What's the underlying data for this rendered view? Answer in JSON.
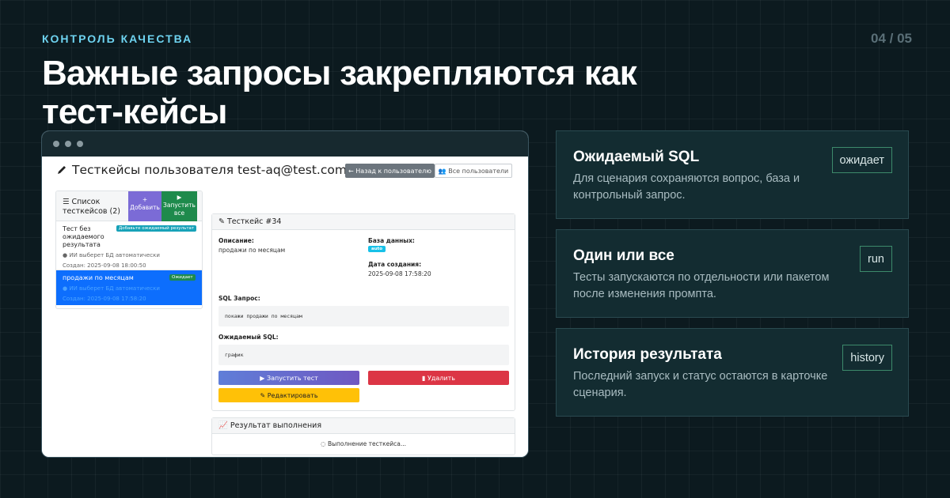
{
  "eyebrow": "КОНТРОЛЬ КАЧЕСТВА",
  "pager": "04 / 05",
  "headline": "Важные запросы закрепляются как тест-кейсы",
  "app": {
    "title": "Тесткейсы пользователя test-aq@test.com",
    "back_button": "Назад к пользователю",
    "all_users_button": "Все пользователи",
    "list": {
      "title": "Список тесткейсов (2)",
      "add_button": "Добавить",
      "run_all_button": "Запустить все",
      "items": [
        {
          "name": "Тест без ожидаемого результата",
          "badge": "Добавьте ожидаемый результат",
          "db": "ИИ выберет БД автоматически",
          "date": "Создан: 2025-09-08 18:00:50"
        },
        {
          "name": "продажи по месяцам",
          "badge": "Ожидает",
          "db": "ИИ выберет БД автоматически",
          "date": "Создан: 2025-09-08 17:58:20"
        }
      ]
    },
    "detail": {
      "title": "Тесткейс #34",
      "description_label": "Описание:",
      "description_value": "продажи по месяцам",
      "db_label": "База данных:",
      "db_value": "auto",
      "created_label": "Дата создания:",
      "created_value": "2025-09-08 17:58:20",
      "sql_label": "SQL Запрос:",
      "sql_value": "покажи продажи по месяцам",
      "expected_label": "Ожидаемый SQL:",
      "expected_value": "график",
      "run_button": "Запустить тест",
      "delete_button": "Удалить",
      "edit_button": "Редактировать"
    },
    "result": {
      "title": "Результат выполнения",
      "status": "Выполнение тесткейса..."
    }
  },
  "features": [
    {
      "title": "Ожидаемый SQL",
      "desc": "Для сценария сохраняются вопрос, база и контрольный запрос.",
      "tag": "ожидает"
    },
    {
      "title": "Один или все",
      "desc": "Тесты запускаются по отдельности или пакетом после изменения промпта.",
      "tag": "run"
    },
    {
      "title": "История результата",
      "desc": "Последний запуск и статус остаются в карточке сценария.",
      "tag": "history"
    }
  ]
}
